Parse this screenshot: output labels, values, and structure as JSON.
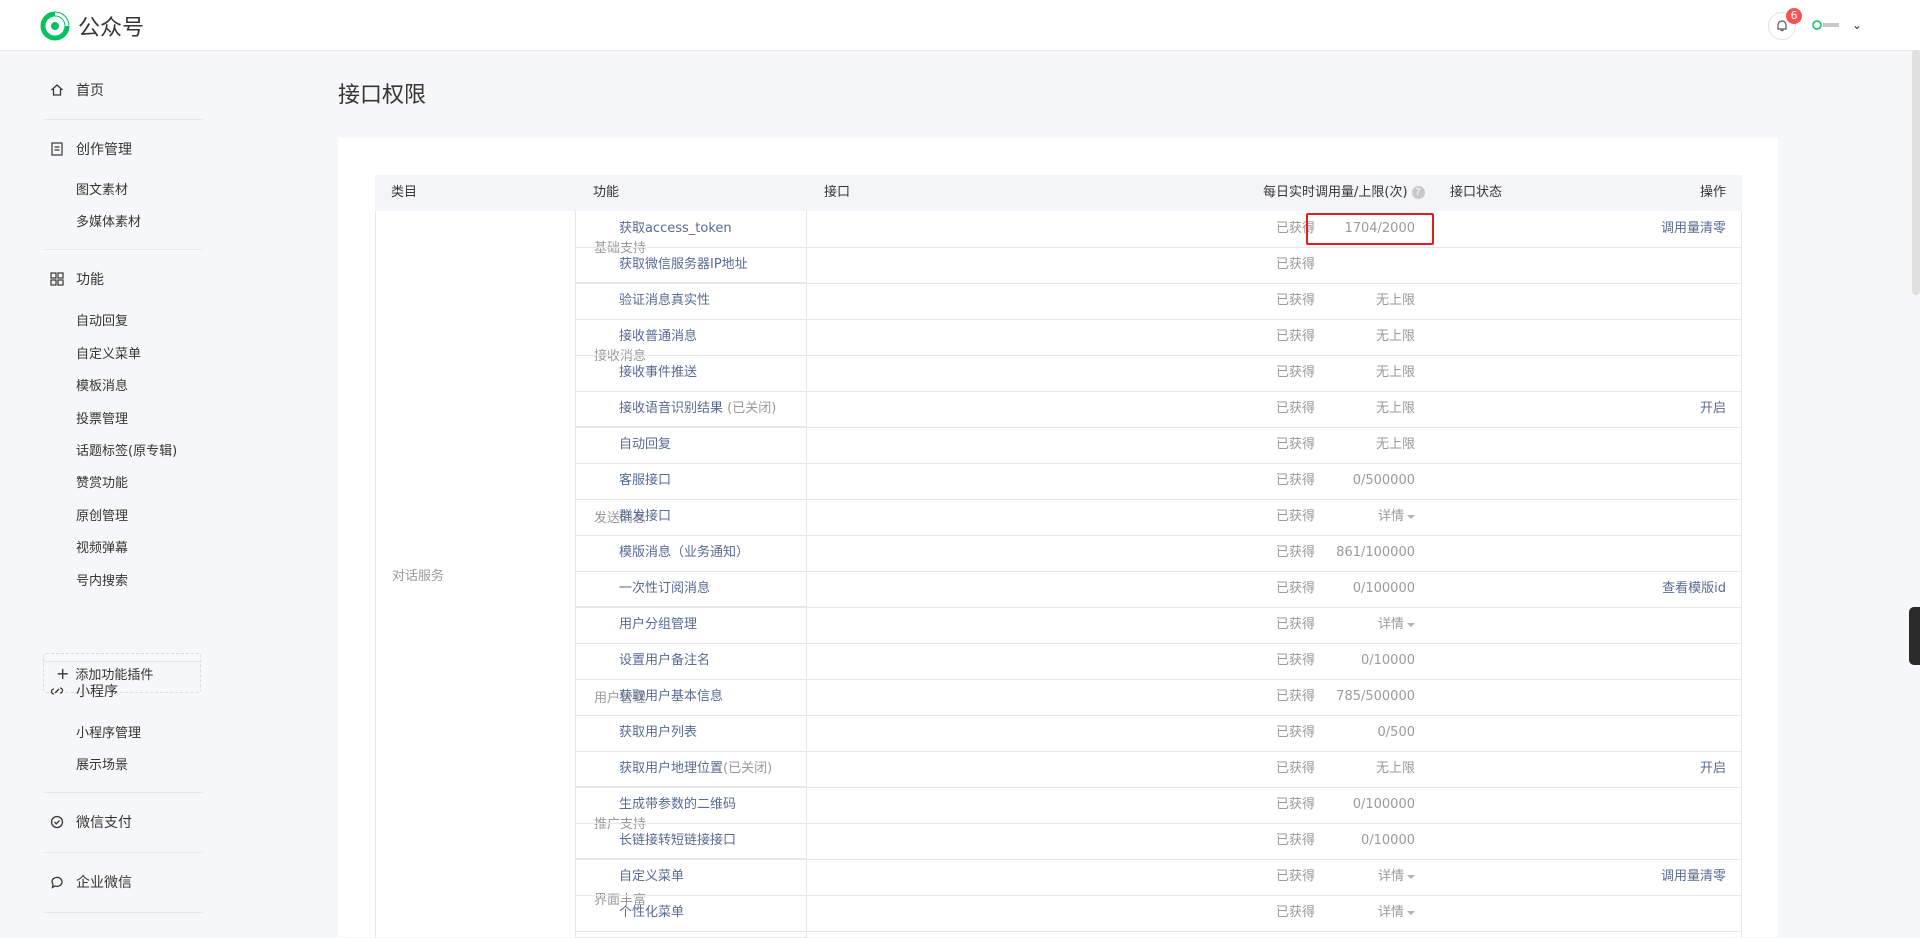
{
  "header": {
    "logo_text": "公众号",
    "brand_color": "#07c160",
    "notification_count": "6"
  },
  "sidebar": {
    "home": "首页",
    "creation": {
      "title": "创作管理",
      "items": [
        "图文素材",
        "多媒体素材"
      ]
    },
    "features": {
      "title": "功能",
      "items": [
        "自动回复",
        "自定义菜单",
        "模板消息",
        "投票管理",
        "话题标签(原专辑)",
        "赞赏功能",
        "原创管理",
        "视频弹幕",
        "号内搜索"
      ]
    },
    "add_plugin": "添加功能插件",
    "miniprogram": {
      "title": "小程序",
      "items": [
        "小程序管理",
        "展示场景"
      ]
    },
    "wechat_pay": "微信支付",
    "wecom": "企业微信"
  },
  "page": {
    "title": "接口权限"
  },
  "table": {
    "headers": {
      "category": "类目",
      "function": "功能",
      "interface": "接口",
      "usage": "每日实时调用量/上限(次)",
      "status": "接口状态",
      "action": "操作"
    },
    "category": "对话服务",
    "groups": [
      "基础支持",
      "接收消息",
      "发送消息",
      "用户管理",
      "推广支持",
      "界面丰富"
    ],
    "rows": [
      {
        "name": "获取access_token",
        "suffix": "",
        "usage": "1704/2000",
        "status": "已获得",
        "op": "调用量清零"
      },
      {
        "name": "获取微信服务器IP地址",
        "suffix": "",
        "usage": "",
        "status": "已获得",
        "op": ""
      },
      {
        "name": "验证消息真实性",
        "suffix": "",
        "usage": "无上限",
        "status": "已获得",
        "op": ""
      },
      {
        "name": "接收普通消息",
        "suffix": "",
        "usage": "无上限",
        "status": "已获得",
        "op": ""
      },
      {
        "name": "接收事件推送",
        "suffix": "",
        "usage": "无上限",
        "status": "已获得",
        "op": ""
      },
      {
        "name": "接收语音识别结果",
        "suffix": " (已关闭)",
        "usage": "无上限",
        "status": "已获得",
        "op": "开启"
      },
      {
        "name": "自动回复",
        "suffix": "",
        "usage": "无上限",
        "status": "已获得",
        "op": ""
      },
      {
        "name": "客服接口",
        "suffix": "",
        "usage": "0/500000",
        "status": "已获得",
        "op": ""
      },
      {
        "name": "群发接口",
        "suffix": "",
        "usage": "详情",
        "status": "已获得",
        "op": ""
      },
      {
        "name": "模版消息（业务通知）",
        "suffix": "",
        "usage": "861/100000",
        "status": "已获得",
        "op": ""
      },
      {
        "name": "一次性订阅消息",
        "suffix": "",
        "usage": "0/100000",
        "status": "已获得",
        "op": "查看模版id"
      },
      {
        "name": "用户分组管理",
        "suffix": "",
        "usage": "详情",
        "status": "已获得",
        "op": ""
      },
      {
        "name": "设置用户备注名",
        "suffix": "",
        "usage": "0/10000",
        "status": "已获得",
        "op": ""
      },
      {
        "name": "获取用户基本信息",
        "suffix": "",
        "usage": "785/500000",
        "status": "已获得",
        "op": ""
      },
      {
        "name": "获取用户列表",
        "suffix": "",
        "usage": "0/500",
        "status": "已获得",
        "op": ""
      },
      {
        "name": "获取用户地理位置",
        "suffix": "(已关闭)",
        "usage": "无上限",
        "status": "已获得",
        "op": "开启"
      },
      {
        "name": "生成带参数的二维码",
        "suffix": "",
        "usage": "0/100000",
        "status": "已获得",
        "op": ""
      },
      {
        "name": "长链接转短链接接口",
        "suffix": "",
        "usage": "0/10000",
        "status": "已获得",
        "op": ""
      },
      {
        "name": "自定义菜单",
        "suffix": "",
        "usage": "详情",
        "status": "已获得",
        "op": "调用量清零"
      },
      {
        "name": "个性化菜单",
        "suffix": "",
        "usage": "详情",
        "status": "已获得",
        "op": ""
      }
    ]
  }
}
